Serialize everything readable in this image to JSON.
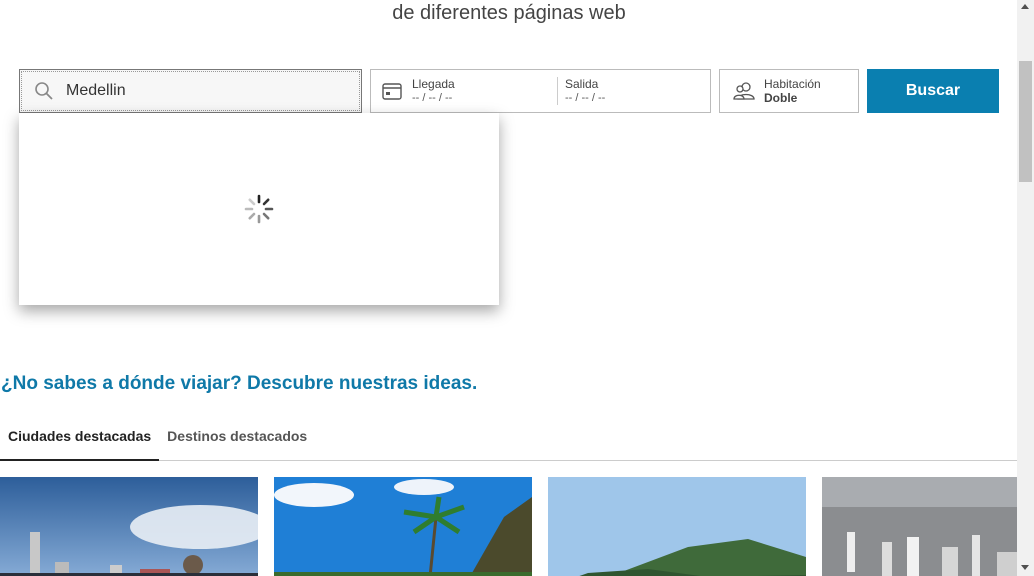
{
  "header": {
    "subtitle": "de diferentes páginas web"
  },
  "search": {
    "value": "Medellin",
    "icon": "search-icon",
    "dropdown_state": "loading"
  },
  "dates": {
    "arrival_label": "Llegada",
    "arrival_value": "-- / -- / --",
    "departure_label": "Salida",
    "departure_value": "-- / -- / --",
    "icon": "calendar-icon"
  },
  "room": {
    "label": "Habitación",
    "value": "Doble",
    "icon": "people-icon"
  },
  "search_button": {
    "label": "Buscar"
  },
  "ideas": {
    "heading": "¿No sabes a dónde viajar? Descubre nuestras ideas.",
    "tabs": [
      {
        "label": "Ciudades destacadas",
        "active": true
      },
      {
        "label": "Destinos destacados",
        "active": false
      }
    ]
  },
  "cards": [
    {
      "name": "city-card-1"
    },
    {
      "name": "city-card-2"
    },
    {
      "name": "city-card-3"
    },
    {
      "name": "city-card-4"
    }
  ],
  "colors": {
    "accent": "#0a7fb0",
    "heading": "#0f79a8"
  }
}
